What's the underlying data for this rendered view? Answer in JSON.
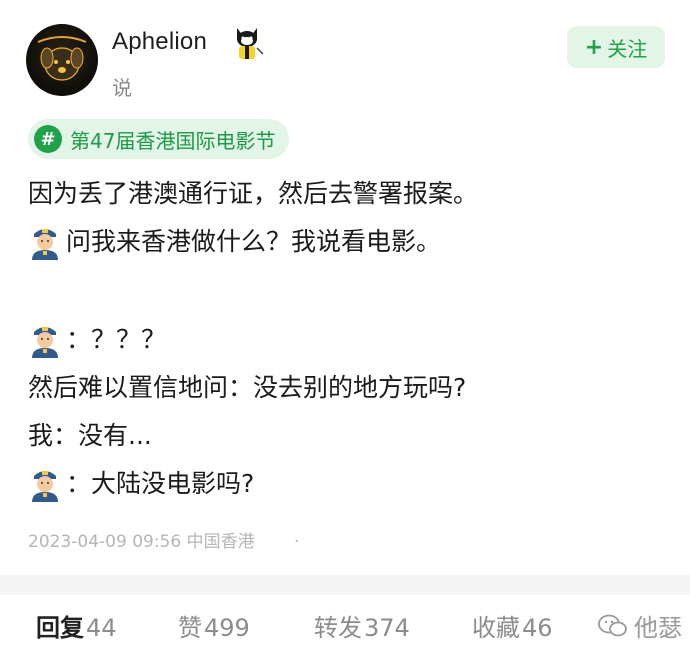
{
  "post": {
    "username": "Aphelion",
    "avatar_icon": "dog-avatar-icon",
    "badge_icon": "cat-badge-icon",
    "subline": "说",
    "follow_label": "关注",
    "topic": "第47届香港国际电影节",
    "lines": [
      "因为丢了港澳通行证，然后去警署报案。",
      "问我来香港做什么？我说看电影。",
      "",
      "：？？？",
      "然后难以置信地问：没去别的地方玩吗?",
      "我：没有...",
      "：大陆没电影吗?"
    ],
    "meta": {
      "timestamp": "2023-04-09 09:56",
      "location": "中国香港",
      "dot": "·"
    }
  },
  "actions": {
    "reply": {
      "label": "回复",
      "count": "44"
    },
    "like": {
      "label": "赞",
      "count": "499"
    },
    "repost": {
      "label": "转发",
      "count": "374"
    },
    "favorite": {
      "label": "收藏",
      "count": "46"
    },
    "more": {
      "label": "他瑟"
    }
  },
  "colors": {
    "accent_green": "#20a14a",
    "green_bg": "#e3f5e6",
    "muted_text": "#8a8a8a"
  }
}
